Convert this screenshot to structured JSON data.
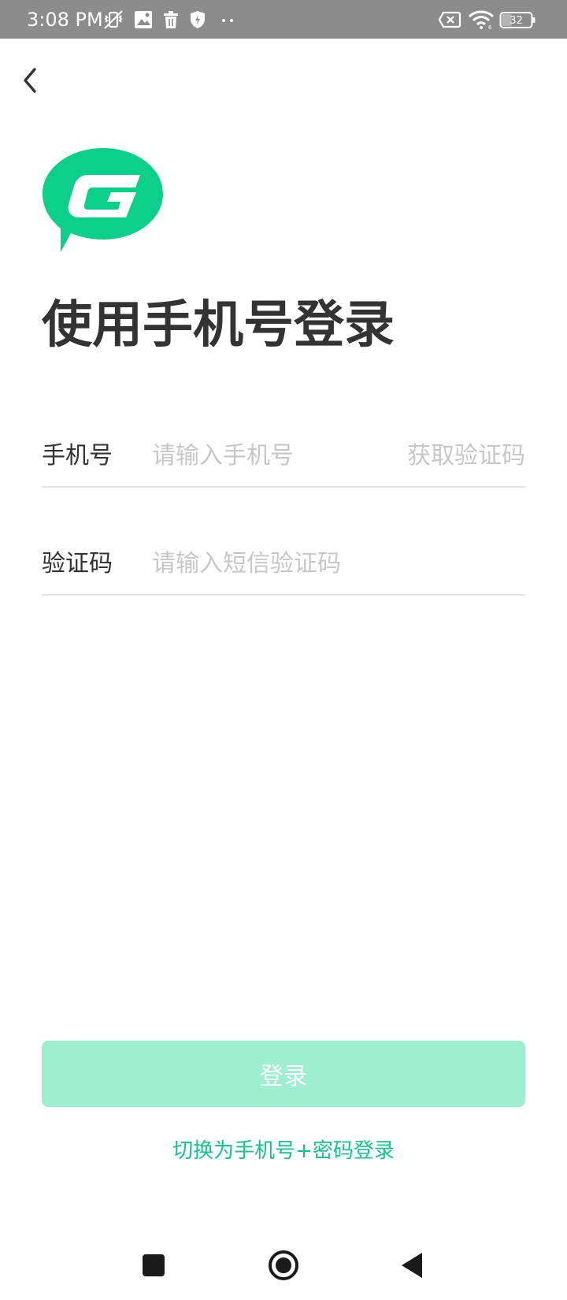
{
  "status_bar": {
    "time": "3:08 PM",
    "battery": "32",
    "icons": [
      "vibrate-off-icon",
      "gallery-icon",
      "trash-icon",
      "shield-icon",
      "more-dots-icon",
      "sim-off-icon",
      "wifi-icon",
      "battery-icon"
    ]
  },
  "header": {
    "back_icon": "chevron-left-icon"
  },
  "logo": {
    "name": "app-logo",
    "color": "#0ccf8a"
  },
  "page": {
    "title": "使用手机号登录"
  },
  "form": {
    "phone": {
      "label": "手机号",
      "placeholder": "请输入手机号",
      "value": "",
      "get_code_label": "获取验证码"
    },
    "code": {
      "label": "验证码",
      "placeholder": "请输入短信验证码",
      "value": ""
    }
  },
  "actions": {
    "login_label": "登录",
    "switch_label": "切换为手机号+密码登录"
  },
  "colors": {
    "accent": "#15c48b",
    "button_disabled": "#9eeed0",
    "status_bar": "#8c8c8c"
  },
  "nav": {
    "icons": [
      "square-recents-icon",
      "circle-home-icon",
      "triangle-back-icon"
    ]
  }
}
